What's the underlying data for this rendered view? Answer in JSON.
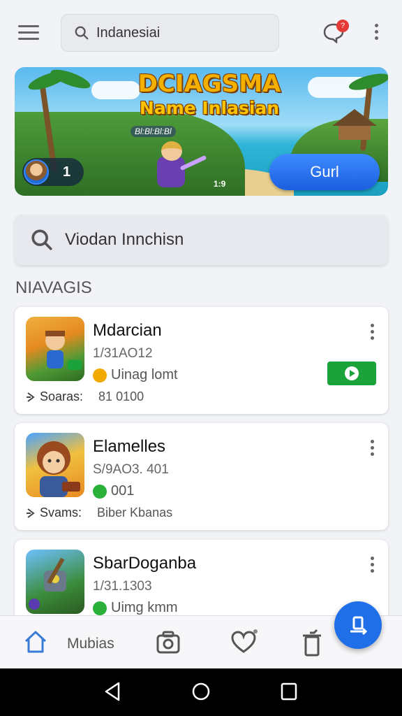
{
  "topbar": {
    "search_value": "Indanesiai",
    "notification_count": "?"
  },
  "banner": {
    "title": "DCIAGSMA",
    "subtitle": "Name Inlasian",
    "tag": "Bl:Bl:Bl:Bl",
    "player_count": "1",
    "stat": "1:9",
    "button_label": "Gurl"
  },
  "search": {
    "value": "Viodan Innchisn"
  },
  "section": {
    "title": "NIAVAGIS"
  },
  "cards": [
    {
      "name": "Mdarcian",
      "date": "1/31AO12",
      "tag_label": "Uinag lomt",
      "foot_label": "Soaras:",
      "foot_value": "81 0100",
      "tag_color": "#f2a900",
      "has_play": true
    },
    {
      "name": "Elamelles",
      "date": "S/9AO3. 401",
      "tag_label": "001",
      "foot_label": "Svams:",
      "foot_value": "Biber Kbanas",
      "tag_color": "#2bb03a",
      "has_play": false
    },
    {
      "name": "SbarDoganba",
      "date": "1/31.1303",
      "tag_label": "Uimg kmm",
      "foot_label": "",
      "foot_value": "",
      "tag_color": "#2bb03a",
      "has_play": false
    }
  ],
  "bottom_nav": {
    "label": "Mubias"
  },
  "colors": {
    "accent": "#1f6fe8",
    "play": "#1aa33a",
    "badge": "#e53935"
  },
  "icons": [
    "menu-icon",
    "search-icon",
    "chat-icon",
    "more-vert-icon",
    "home-icon",
    "camera-icon",
    "heart-icon",
    "trash-icon",
    "upload-icon",
    "back-icon",
    "home-circle-icon",
    "recents-icon"
  ]
}
